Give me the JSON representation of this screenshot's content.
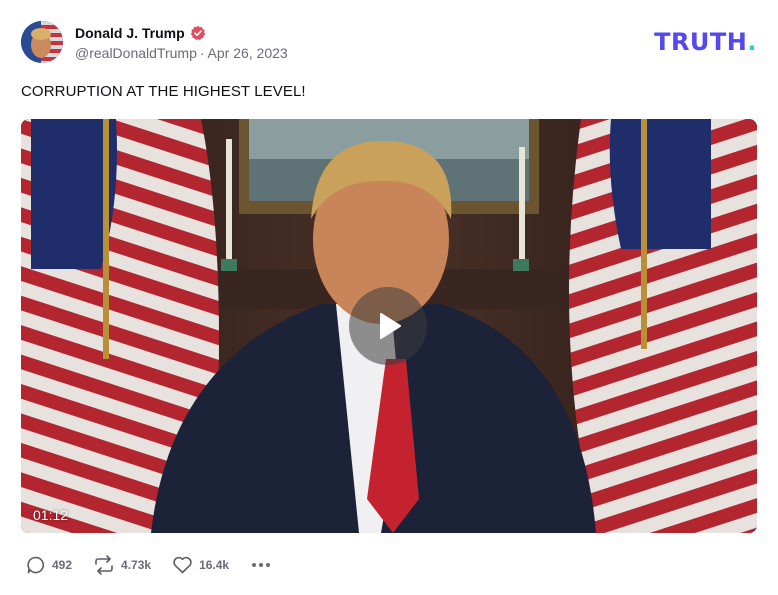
{
  "author": {
    "display_name": "Donald J. Trump",
    "handle": "@realDonaldTrump",
    "date": "Apr 26, 2023",
    "verified": true,
    "avatar_icon": "avatar-image"
  },
  "brand": {
    "name": "TRUTH",
    "dot": ".",
    "color": "#5448ee",
    "dot_color": "#27d4c4"
  },
  "post": {
    "text": "CORRUPTION AT THE HIGHEST LEVEL!"
  },
  "video": {
    "duration": "01:12",
    "play_icon": "play-icon"
  },
  "actions": {
    "replies": {
      "icon": "reply-icon",
      "count": "492"
    },
    "retruths": {
      "icon": "retruth-icon",
      "count": "4.73k"
    },
    "likes": {
      "icon": "heart-icon",
      "count": "16.4k"
    },
    "more_icon": "more-icon"
  }
}
